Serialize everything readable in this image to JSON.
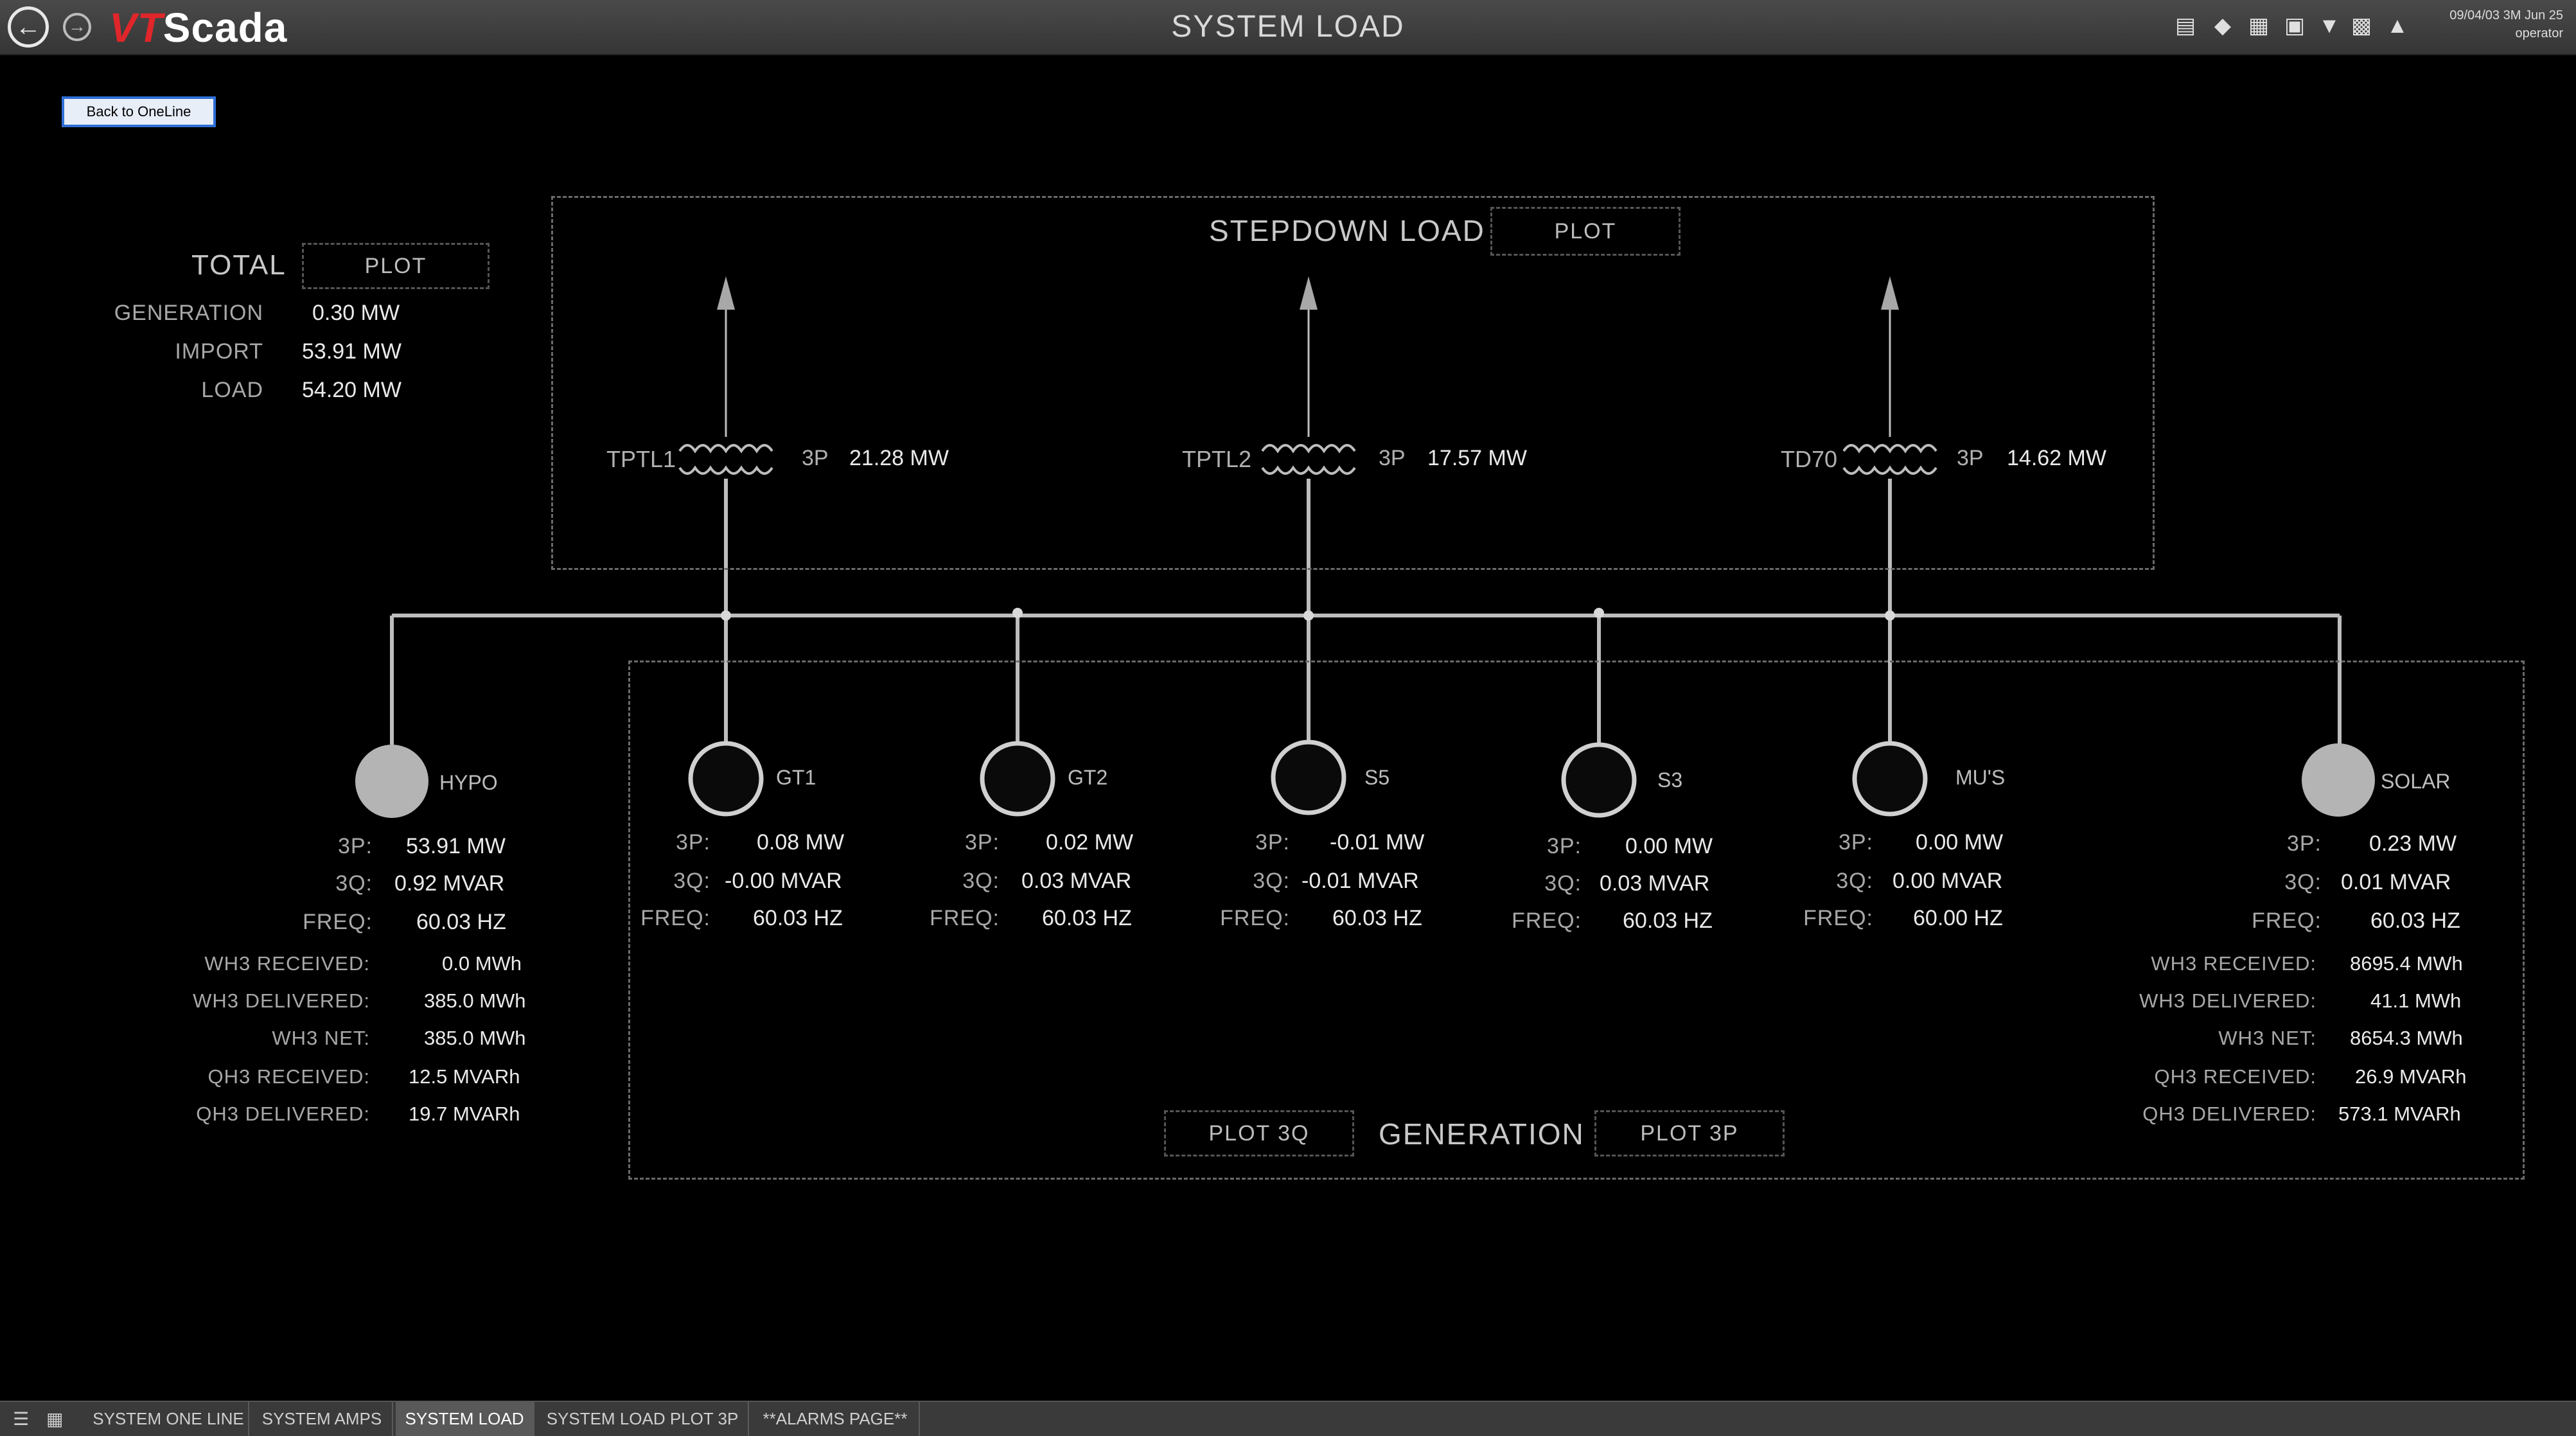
{
  "app": {
    "logo_vt": "VT",
    "logo_scada": "Scada",
    "page_title": "SYSTEM LOAD",
    "datetime_line1": "09/04/03 3M  Jun 25",
    "datetime_line2": "operator"
  },
  "back_button": "Back to OneLine",
  "total": {
    "title": "TOTAL",
    "plot_label": "PLOT",
    "rows": [
      {
        "label": "GENERATION",
        "value": "0.30 MW"
      },
      {
        "label": "IMPORT",
        "value": "53.91 MW"
      },
      {
        "label": "LOAD",
        "value": "54.20 MW"
      }
    ]
  },
  "stepdown": {
    "title": "STEPDOWN LOAD",
    "plot_label": "PLOT",
    "transformers": [
      {
        "name": "TPTL1",
        "label": "3P",
        "value": "21.28 MW"
      },
      {
        "name": "TPTL2",
        "label": "3P",
        "value": "17.57 MW"
      },
      {
        "name": "TD70",
        "label": "3P",
        "value": "14.62 MW"
      }
    ]
  },
  "generation": {
    "title": "GENERATION",
    "plot3q_label": "PLOT 3Q",
    "plot3p_label": "PLOT 3P",
    "units": [
      {
        "name": "GT1",
        "p": "0.08 MW",
        "q": "-0.00 MVAR",
        "f": "60.03 HZ"
      },
      {
        "name": "GT2",
        "p": "0.02 MW",
        "q": "0.03 MVAR",
        "f": "60.03 HZ"
      },
      {
        "name": "S5",
        "p": "-0.01 MW",
        "q": "-0.01 MVAR",
        "f": "60.03 HZ"
      },
      {
        "name": "S3",
        "p": "0.00 MW",
        "q": "0.03 MVAR",
        "f": "60.03 HZ"
      },
      {
        "name": "MU'S",
        "p": "0.00 MW",
        "q": "0.00 MVAR",
        "f": "60.00 HZ"
      }
    ]
  },
  "labels": {
    "p": "3P:",
    "q": "3Q:",
    "f": "FREQ:"
  },
  "hypo": {
    "name": "HYPO",
    "p": "53.91 MW",
    "q": "0.92 MVAR",
    "f": "60.03 HZ",
    "energy": [
      {
        "label": "WH3 RECEIVED:",
        "value": "0.0 MWh"
      },
      {
        "label": "WH3 DELIVERED:",
        "value": "385.0 MWh"
      },
      {
        "label": "WH3 NET:",
        "value": "385.0 MWh"
      },
      {
        "label": "QH3 RECEIVED:",
        "value": "12.5 MVARh"
      },
      {
        "label": "QH3 DELIVERED:",
        "value": "19.7 MVARh"
      }
    ]
  },
  "solar": {
    "name": "SOLAR",
    "p": "0.23 MW",
    "q": "0.01 MVAR",
    "f": "60.03 HZ",
    "energy": [
      {
        "label": "WH3 RECEIVED:",
        "value": "8695.4 MWh"
      },
      {
        "label": "WH3 DELIVERED:",
        "value": "41.1 MWh"
      },
      {
        "label": "WH3 NET:",
        "value": "8654.3 MWh"
      },
      {
        "label": "QH3 RECEIVED:",
        "value": "26.9 MVARh"
      },
      {
        "label": "QH3 DELIVERED:",
        "value": "573.1 MVARh"
      }
    ]
  },
  "taskbar": {
    "tabs": [
      {
        "label": "SYSTEM ONE LINE"
      },
      {
        "label": "SYSTEM AMPS"
      },
      {
        "label": "SYSTEM LOAD"
      },
      {
        "label": "SYSTEM LOAD PLOT 3P"
      },
      {
        "label": "**ALARMS PAGE**"
      }
    ]
  },
  "colors": {
    "bus": "#bdbdbd",
    "node_fill_gray": "#b4b4b4",
    "node_fill_dark": "#0a0a0a",
    "logo_red": "#e0262a"
  },
  "icons": [
    "back-arrow-icon",
    "forward-arrow-icon",
    "trend-icon",
    "tag-icon",
    "network-icon",
    "report-icon",
    "filter-icon",
    "print-icon",
    "alarm-bell-icon",
    "list-view-icon",
    "grid-view-icon"
  ]
}
